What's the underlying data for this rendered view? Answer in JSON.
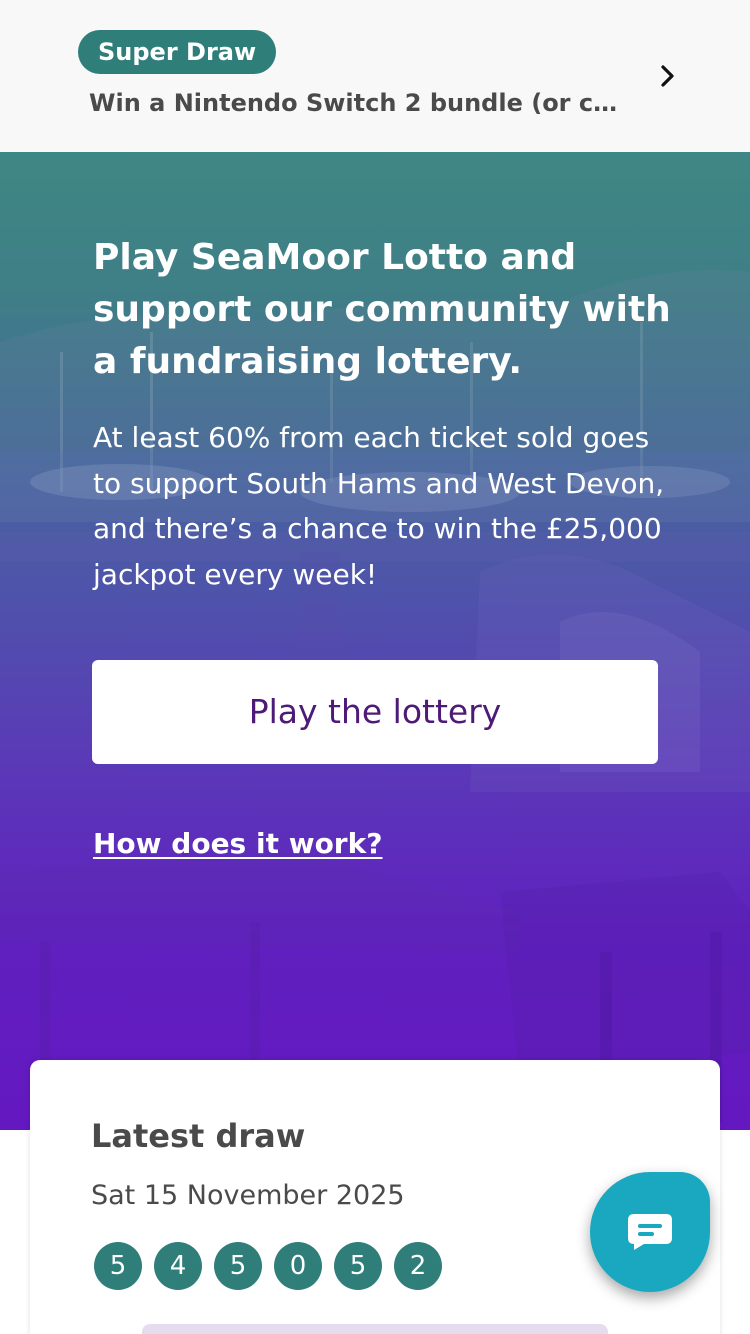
{
  "promo": {
    "badge": "Super Draw",
    "text": "Win a Nintendo Switch 2 bundle (or c…",
    "chevron_icon": "chevron-right-icon"
  },
  "hero": {
    "title": "Play SeaMoor Lotto and support our community with a fundraising lottery.",
    "description": "At least 60% from each ticket sold goes to support South Hams and West Devon, and there’s a chance to win the £25,000 jackpot every week!",
    "play_button": "Play the lottery",
    "how_link": "How does it work?"
  },
  "latest_draw": {
    "title": "Latest draw",
    "date": "Sat 15 November 2025",
    "numbers": [
      "5",
      "4",
      "5",
      "0",
      "5",
      "2"
    ]
  },
  "chat": {
    "icon": "chat-bubble-icon"
  },
  "colors": {
    "teal": "#2f7e7a",
    "purple_text": "#4d1a78",
    "hero_top": "#3f8784",
    "hero_bottom": "#6418c0",
    "chat": "#1aa8c0"
  }
}
